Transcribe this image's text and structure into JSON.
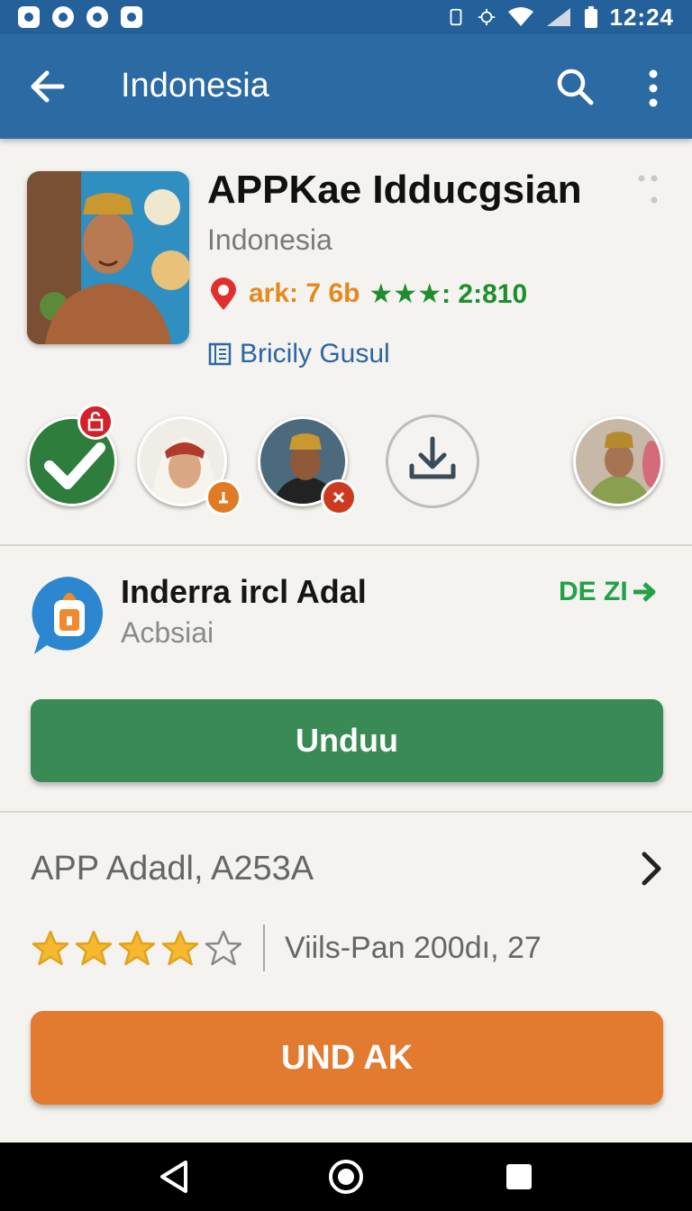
{
  "status_bar": {
    "time": "12:24",
    "icons": [
      "app-notification-icon",
      "podcast-icon",
      "shield-icon",
      "save-icon",
      "vibrate-icon",
      "bluetooth-icon",
      "wifi-icon",
      "signal-icon",
      "battery-icon"
    ]
  },
  "app_bar": {
    "title": "Indonesia"
  },
  "app": {
    "name": "APPKae Idducgsian",
    "country": "Indonesia",
    "rating_prefix": "ark: 7 6b",
    "rating_suffix": "★★★: 2:810",
    "developer": "Bricily Gusul"
  },
  "feature": {
    "title": "Inderra ircl Adal",
    "subtitle": "Acbsiai",
    "link": "DE ZI"
  },
  "buttons": {
    "download": "Unduu",
    "install": "UND AK"
  },
  "info": {
    "label": "APP Adadl, A253A",
    "rating_stars": 4,
    "rating_max": 5,
    "version": "Viils-Pan 200dı, 27"
  },
  "colors": {
    "primary": "#2c6aa4",
    "download": "#3a8a55",
    "install": "#e27a30",
    "accent_green": "#21a14a",
    "star": "#f5b82e"
  }
}
